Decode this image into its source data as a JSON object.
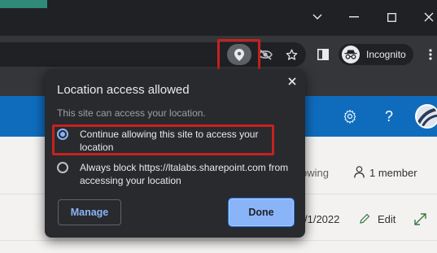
{
  "browser": {
    "mode_label": "Incognito",
    "window_buttons": [
      "chevron-down-icon",
      "minimize-icon",
      "maximize-icon",
      "close-icon"
    ],
    "toolbar_icons": [
      "location-pin-icon",
      "eye-off-icon",
      "star-icon",
      "side-panel-icon",
      "more-vert-icon"
    ]
  },
  "popup": {
    "title": "Location access allowed",
    "subtitle": "This site can access your location.",
    "options": [
      {
        "label": "Continue allowing this site to access your location",
        "selected": true
      },
      {
        "label": "Always block https://ltalabs.sharepoint.com from accessing your location",
        "selected": false
      }
    ],
    "manage_label": "Manage",
    "done_label": "Done"
  },
  "page": {
    "following_text": "owing",
    "members_text": "1 member",
    "date_text": "/1/2022",
    "edit_label": "Edit"
  },
  "colors": {
    "accent": "#8ab4f8",
    "highlight": "#c5221f",
    "sharepoint_bar": "#0f6cbd",
    "popup_bg": "#292a2d"
  }
}
